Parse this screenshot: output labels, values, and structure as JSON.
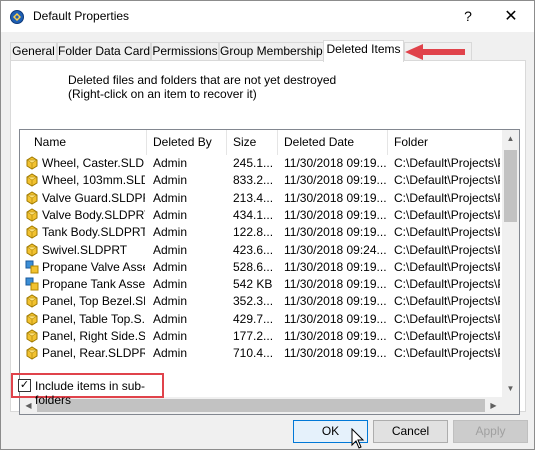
{
  "window": {
    "title": "Default Properties",
    "help_label": "?",
    "close_label": "✕"
  },
  "tabs": [
    {
      "label": "General"
    },
    {
      "label": "Folder Data Card"
    },
    {
      "label": "Permissions"
    },
    {
      "label": "Group Memberships"
    },
    {
      "label": "Deleted Items"
    }
  ],
  "panel": {
    "description_line1": "Deleted files and folders that are not yet destroyed",
    "description_line2": "(Right-click on an item to recover it)"
  },
  "list": {
    "columns": [
      "Name",
      "Deleted By",
      "Size",
      "Deleted Date",
      "Folder"
    ],
    "rows": [
      {
        "name": "Wheel, Caster.SLD...",
        "deleted_by": "Admin",
        "size": "245.1...",
        "date": "11/30/2018 09:19...",
        "folder": "C:\\Default\\Projects\\P-",
        "icon": "part-icon"
      },
      {
        "name": "Wheel, 103mm.SLD...",
        "deleted_by": "Admin",
        "size": "833.2...",
        "date": "11/30/2018 09:19...",
        "folder": "C:\\Default\\Projects\\P-",
        "icon": "part-icon"
      },
      {
        "name": "Valve Guard.SLDPRT",
        "deleted_by": "Admin",
        "size": "213.4...",
        "date": "11/30/2018 09:19...",
        "folder": "C:\\Default\\Projects\\P-",
        "icon": "part-icon"
      },
      {
        "name": "Valve Body.SLDPRT",
        "deleted_by": "Admin",
        "size": "434.1...",
        "date": "11/30/2018 09:19...",
        "folder": "C:\\Default\\Projects\\P-",
        "icon": "part-icon"
      },
      {
        "name": "Tank Body.SLDPRT",
        "deleted_by": "Admin",
        "size": "122.8...",
        "date": "11/30/2018 09:19...",
        "folder": "C:\\Default\\Projects\\P-",
        "icon": "part-icon"
      },
      {
        "name": "Swivel.SLDPRT",
        "deleted_by": "Admin",
        "size": "423.6...",
        "date": "11/30/2018 09:24...",
        "folder": "C:\\Default\\Projects\\P-",
        "icon": "part-icon"
      },
      {
        "name": "Propane Valve Asse...",
        "deleted_by": "Admin",
        "size": "528.6...",
        "date": "11/30/2018 09:19...",
        "folder": "C:\\Default\\Projects\\P-",
        "icon": "assembly-icon"
      },
      {
        "name": "Propane Tank Asse...",
        "deleted_by": "Admin",
        "size": "542 KB",
        "date": "11/30/2018 09:19...",
        "folder": "C:\\Default\\Projects\\P-",
        "icon": "assembly-icon"
      },
      {
        "name": "Panel, Top Bezel.SL...",
        "deleted_by": "Admin",
        "size": "352.3...",
        "date": "11/30/2018 09:19...",
        "folder": "C:\\Default\\Projects\\P-",
        "icon": "part-icon"
      },
      {
        "name": "Panel, Table Top.S...",
        "deleted_by": "Admin",
        "size": "429.7...",
        "date": "11/30/2018 09:19...",
        "folder": "C:\\Default\\Projects\\P-",
        "icon": "part-icon"
      },
      {
        "name": "Panel, Right Side.S...",
        "deleted_by": "Admin",
        "size": "177.2...",
        "date": "11/30/2018 09:19...",
        "folder": "C:\\Default\\Projects\\P-",
        "icon": "part-icon"
      },
      {
        "name": "Panel, Rear.SLDPRT",
        "deleted_by": "Admin",
        "size": "710.4...",
        "date": "11/30/2018 09:19...",
        "folder": "C:\\Default\\Projects\\P-",
        "icon": "part-icon"
      }
    ]
  },
  "options": {
    "include_subfolders_label": "Include items in sub-folders",
    "include_subfolders_checked": true
  },
  "buttons": {
    "ok": "OK",
    "cancel": "Cancel",
    "apply": "Apply"
  },
  "colors": {
    "highlight_red": "#e0434b",
    "accent_blue": "#0078d7"
  }
}
